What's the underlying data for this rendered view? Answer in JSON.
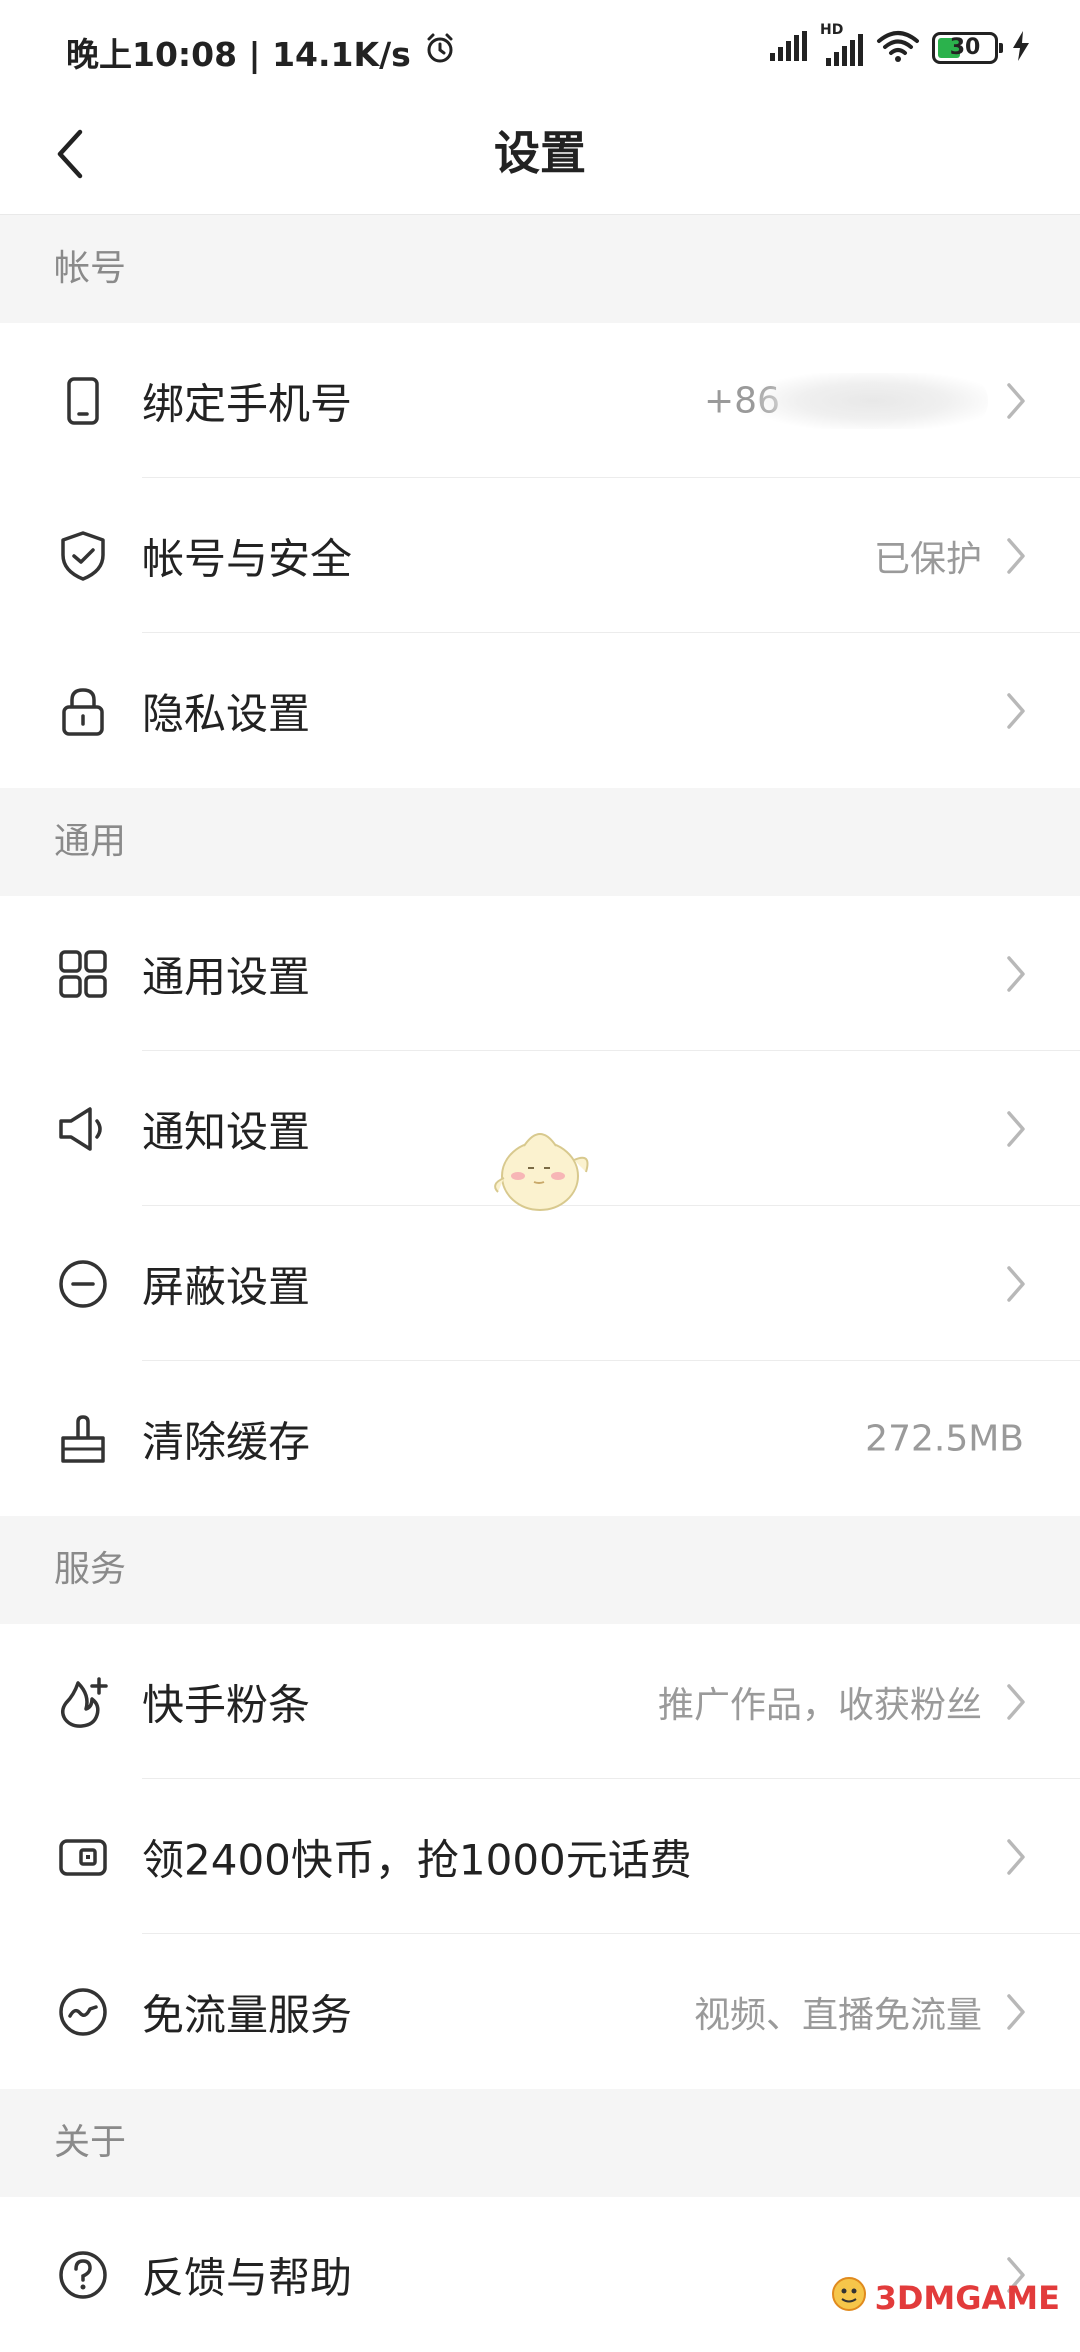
{
  "status_bar": {
    "time_text": "晚上10:08 | 14.1K/s",
    "battery_level": "30",
    "hd_label": "HD"
  },
  "header": {
    "title": "设置"
  },
  "sections": [
    {
      "title": "帐号",
      "items": [
        {
          "label": "绑定手机号",
          "value": "+86",
          "icon": "phone-icon",
          "chevron": true
        },
        {
          "label": "帐号与安全",
          "value": "已保护",
          "icon": "shield-check-icon",
          "chevron": true
        },
        {
          "label": "隐私设置",
          "value": "",
          "icon": "lock-icon",
          "chevron": true
        }
      ]
    },
    {
      "title": "通用",
      "items": [
        {
          "label": "通用设置",
          "value": "",
          "icon": "grid-icon",
          "chevron": true
        },
        {
          "label": "通知设置",
          "value": "",
          "icon": "speaker-icon",
          "chevron": true
        },
        {
          "label": "屏蔽设置",
          "value": "",
          "icon": "minus-circle-icon",
          "chevron": true
        },
        {
          "label": "清除缓存",
          "value": "272.5MB",
          "icon": "broom-icon",
          "chevron": false
        }
      ]
    },
    {
      "title": "服务",
      "items": [
        {
          "label": "快手粉条",
          "value": "推广作品，收获粉丝",
          "icon": "flame-plus-icon",
          "chevron": true
        },
        {
          "label": "领2400快币，抢1000元话费",
          "value": "",
          "icon": "wallet-icon",
          "chevron": true
        },
        {
          "label": "免流量服务",
          "value": "视频、直播免流量",
          "icon": "wave-circle-icon",
          "chevron": true
        }
      ]
    },
    {
      "title": "关于",
      "items": [
        {
          "label": "反馈与帮助",
          "value": "",
          "icon": "question-circle-icon",
          "chevron": true
        }
      ]
    }
  ],
  "watermark": {
    "text": "3DMGAME"
  }
}
